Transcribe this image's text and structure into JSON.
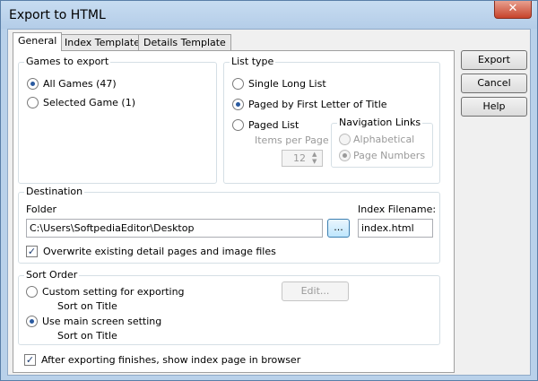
{
  "window": {
    "title": "Export to HTML",
    "close_glyph": "✕"
  },
  "tabs": [
    {
      "label": "General"
    },
    {
      "label": "Index Template"
    },
    {
      "label": "Details Template"
    }
  ],
  "games_to_export": {
    "legend": "Games to export",
    "options": [
      {
        "label": "All Games (47)",
        "checked": true
      },
      {
        "label": "Selected Game (1)",
        "checked": false
      }
    ]
  },
  "list_type": {
    "legend": "List type",
    "options": [
      {
        "label": "Single Long List",
        "checked": false
      },
      {
        "label": "Paged by First Letter of Title",
        "checked": true
      },
      {
        "label": "Paged List",
        "checked": false
      }
    ],
    "items_per_page_label": "Items per Page",
    "items_per_page_value": "12",
    "navigation": {
      "legend": "Navigation Links",
      "options": [
        {
          "label": "Alphabetical",
          "checked": false
        },
        {
          "label": "Page Numbers",
          "checked": true
        }
      ]
    }
  },
  "destination": {
    "legend": "Destination",
    "folder_label": "Folder",
    "folder_value": "C:\\Users\\SoftpediaEditor\\Desktop",
    "browse_label": "...",
    "index_filename_label": "Index Filename:",
    "index_filename_value": "index.html",
    "overwrite_label": "Overwrite existing detail pages and image files",
    "overwrite_checked": true
  },
  "sort_order": {
    "legend": "Sort Order",
    "custom_label": "Custom setting for exporting",
    "custom_sub": "Sort on Title",
    "main_label": "Use main screen setting",
    "main_sub": "Sort on Title",
    "edit_label": "Edit..."
  },
  "after_export": {
    "label": "After exporting finishes, show index page in browser",
    "checked": true
  },
  "buttons": {
    "export": "Export",
    "cancel": "Cancel",
    "help": "Help"
  }
}
